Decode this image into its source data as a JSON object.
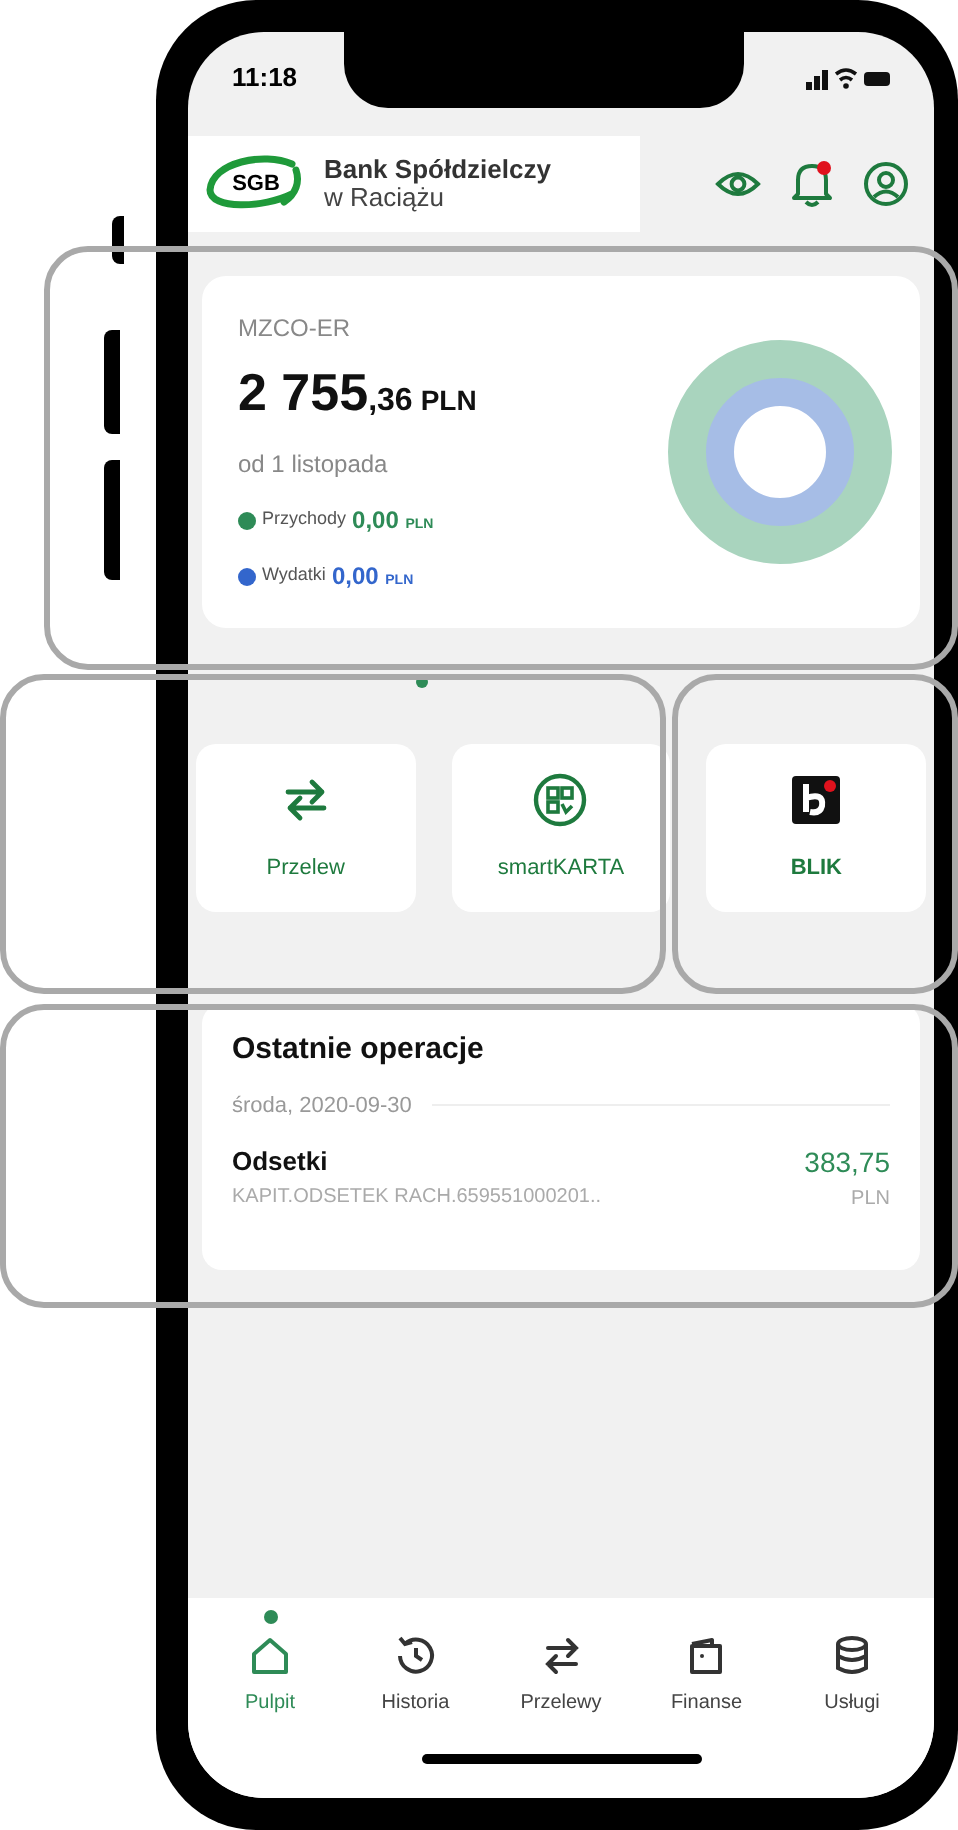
{
  "status_bar": {
    "time": "11:18"
  },
  "header": {
    "bank_name": "Bank Spółdzielczy",
    "bank_location": "w Raciążu",
    "logo_text": "SGB",
    "notification_unread": true
  },
  "account": {
    "name": "MZCO-ER",
    "balance_main": "2 755",
    "balance_decimal": ",36",
    "currency": "PLN",
    "period": "od 1 listopada",
    "legend": [
      {
        "label": "Przychody",
        "amount": "0,00",
        "currency": "PLN",
        "color": "#2e8b57"
      },
      {
        "label": "Wydatki",
        "amount": "0,00",
        "currency": "PLN",
        "color": "#3366cc"
      }
    ]
  },
  "carousel": {
    "pages": [
      {
        "selected": true
      }
    ]
  },
  "shortcuts": [
    {
      "label": "Przelew"
    },
    {
      "label": "smartKARTA"
    },
    {
      "label": "BLIK"
    }
  ],
  "recent": {
    "title": "Ostatnie operacje",
    "date": "środa, 2020-09-30",
    "items": [
      {
        "title": "Odsetki",
        "description": "KAPIT.ODSETEK RACH.659551000201..",
        "amount": "383,75",
        "currency": "PLN"
      }
    ]
  },
  "nav": [
    {
      "label": "Pulpit",
      "selected": true
    },
    {
      "label": "Historia",
      "selected": false
    },
    {
      "label": "Przelewy",
      "selected": false
    },
    {
      "label": "Finanse",
      "selected": false
    },
    {
      "label": "Usługi",
      "selected": false
    }
  ]
}
